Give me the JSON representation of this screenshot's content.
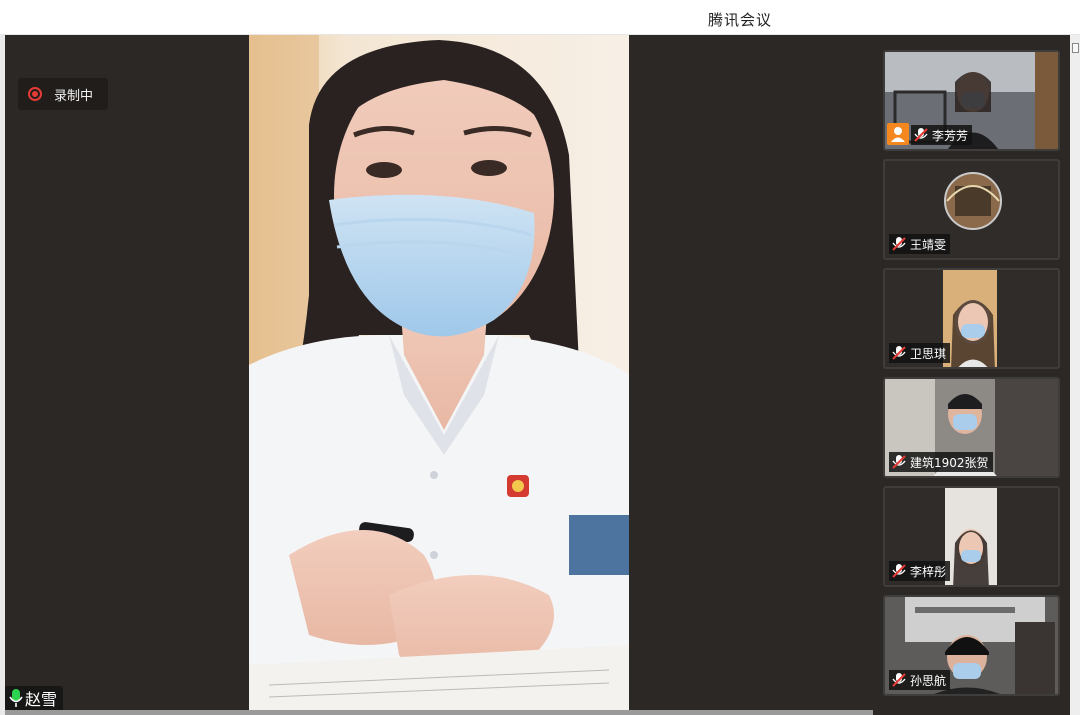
{
  "window": {
    "title": "腾讯会议"
  },
  "recording": {
    "label": "录制中"
  },
  "main_speaker": {
    "name": "赵雪"
  },
  "participants": [
    {
      "name": "李芳芳",
      "mic": "muted",
      "host_badge": true
    },
    {
      "name": "王靖雯",
      "mic": "muted",
      "host_badge": false
    },
    {
      "name": "卫思琪",
      "mic": "muted",
      "host_badge": false
    },
    {
      "name": "建筑1902张贺",
      "mic": "muted",
      "host_badge": false
    },
    {
      "name": "李梓彤",
      "mic": "muted",
      "host_badge": false
    },
    {
      "name": "孙思航",
      "mic": "muted",
      "host_badge": false
    }
  ],
  "icons": {
    "recording": "recording-dot-icon",
    "mic_active": "microphone-icon",
    "mic_muted": "microphone-muted-icon",
    "host": "host-user-icon"
  },
  "colors": {
    "stage_bg": "#2b2826",
    "recording_red": "#e53b36",
    "mic_green": "#2bd34e",
    "host_orange": "#f5871f"
  }
}
